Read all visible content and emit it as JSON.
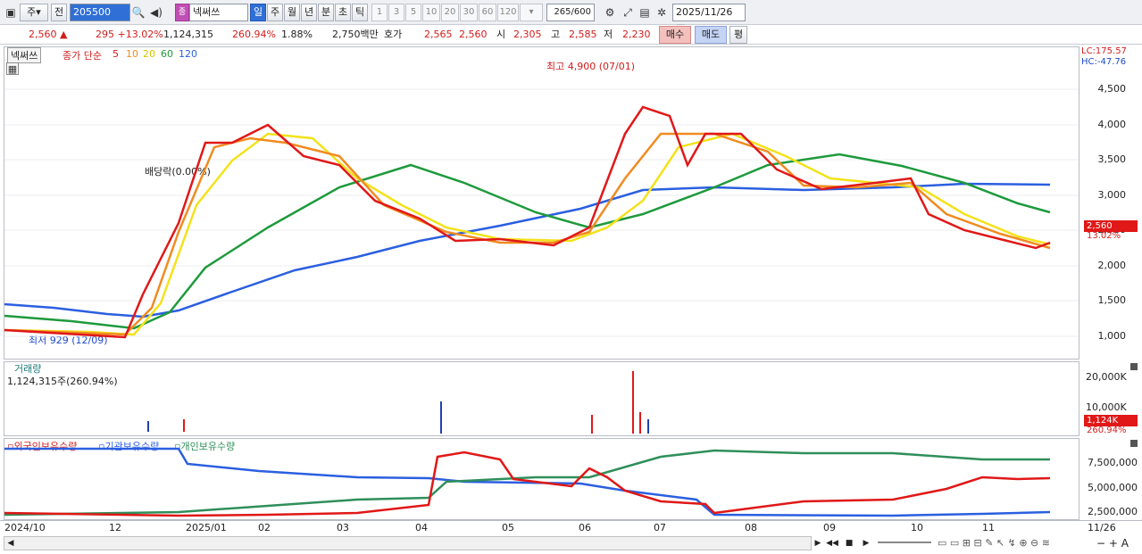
{
  "toolbar": {
    "market": "주",
    "period_type": "전",
    "code": "205500",
    "stock_name": "넥써쓰",
    "tabs": [
      "일",
      "주",
      "월",
      "년",
      "분",
      "초",
      "틱"
    ],
    "active_tab": "일",
    "minute_nums": [
      "1",
      "3",
      "5",
      "10",
      "20",
      "30",
      "60",
      "120"
    ],
    "count": "265",
    "count_max": "/600",
    "date": "2025/11/26"
  },
  "quote": {
    "price": "2,560",
    "arrow": "▲",
    "change": "295",
    "change_pct": "+13.02%",
    "volume": "1,124,315",
    "vol_ratio": "260.94%",
    "turnover": "1.88%",
    "amount": "2,750백만",
    "hoga_label": "호가",
    "ask": "2,565",
    "bid": "2,560",
    "open_label": "시",
    "open": "2,305",
    "high_label": "고",
    "high": "2,585",
    "low_label": "저",
    "low": "2,230",
    "buy": "매수",
    "sell": "매도",
    "eval": "평"
  },
  "legend": {
    "name": "넥써쓰",
    "title": "종가 단순",
    "ma5": "5",
    "ma10": "10",
    "ma20": "20",
    "ma60": "60",
    "ma120": "120"
  },
  "right_info": {
    "lc": "LC:175.57",
    "hc": "HC:-47.76"
  },
  "annotations": {
    "high": "최고 4,900 (07/01)",
    "low": "최저 929 (12/09)",
    "dividend": "배당락(0.00%)"
  },
  "price_axis": [
    "4,500",
    "4,000",
    "3,500",
    "3,000",
    "2,500",
    "2,000",
    "1,500",
    "1,000"
  ],
  "price_tag": {
    "value": "2,560",
    "pct": "13.02%"
  },
  "volume_panel": {
    "title": "거래량",
    "value": "1,124,315주(260.94%)",
    "ticks": [
      "20,000K",
      "10,000K"
    ],
    "tag": "1,124K",
    "tag_pct": "260.94%"
  },
  "holding_panel": {
    "foreign": "외국인보유수량",
    "inst": "기관보유수량",
    "indiv": "개인보유수량",
    "ticks": [
      "7,500,000",
      "5,000,000",
      "2,500,000"
    ]
  },
  "x_axis": [
    "2024/10",
    "12",
    "2025/01",
    "02",
    "03",
    "04",
    "05",
    "06",
    "07",
    "08",
    "09",
    "10",
    "11",
    "11/26"
  ],
  "colors": {
    "ma5": "#e01818",
    "ma10": "#f08c20",
    "ma20": "#f3e21a",
    "ma60": "#1e9a3c",
    "ma120": "#2b5fe0",
    "up": "#e01818",
    "down": "#1f3fb3",
    "foreign": "#e01818",
    "inst": "#2b5fe0",
    "indiv": "#2f8f5a"
  }
}
